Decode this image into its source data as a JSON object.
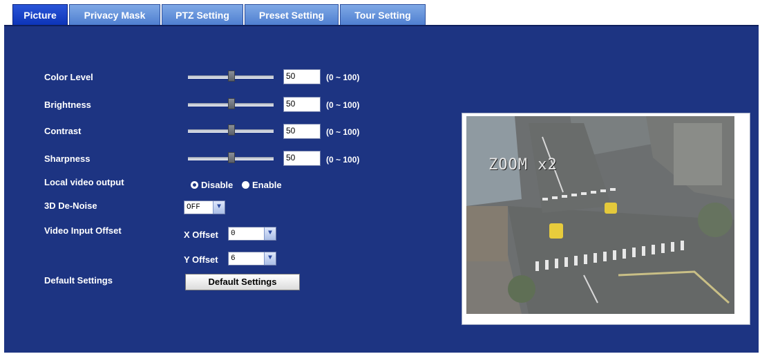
{
  "tabs": [
    {
      "label": "Picture",
      "active": true
    },
    {
      "label": "Privacy Mask",
      "active": false
    },
    {
      "label": "PTZ Setting",
      "active": false
    },
    {
      "label": "Preset Setting",
      "active": false
    },
    {
      "label": "Tour Setting",
      "active": false
    }
  ],
  "settings": {
    "color_level": {
      "label": "Color Level",
      "value": "50",
      "range": "(0 ~ 100)"
    },
    "brightness": {
      "label": "Brightness",
      "value": "50",
      "range": "(0 ~ 100)"
    },
    "contrast": {
      "label": "Contrast",
      "value": "50",
      "range": "(0 ~ 100)"
    },
    "sharpness": {
      "label": "Sharpness",
      "value": "50",
      "range": "(0 ~ 100)"
    },
    "local_video_output": {
      "label": "Local video output",
      "disable": "Disable",
      "enable": "Enable",
      "selected": "Disable"
    },
    "denoise": {
      "label": "3D De-Noise",
      "value": "OFF"
    },
    "video_input_offset": {
      "label": "Video Input Offset",
      "x_label": "X Offset",
      "x_value": "0",
      "y_label": "Y Offset",
      "y_value": "6"
    },
    "default_settings": {
      "label": "Default Settings",
      "button": "Default Settings"
    }
  },
  "preview": {
    "overlay_text": "ZOOM x2"
  },
  "colors": {
    "panel": "#1d3482",
    "tab_active": "#0d34b8",
    "tab_inactive": "#4f7fd0"
  }
}
